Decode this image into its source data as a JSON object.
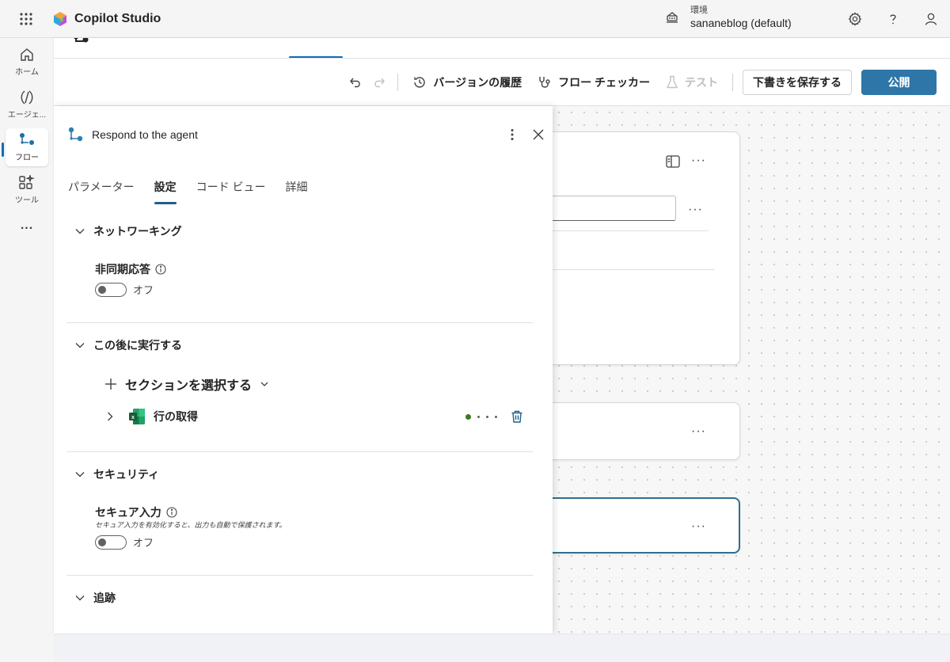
{
  "app": {
    "title": "Copilot Studio"
  },
  "environment": {
    "label": "環境",
    "name": "sananeblog (default)"
  },
  "header_icons": [
    "waffle-icon",
    "environment-icon",
    "gear-icon",
    "help-icon",
    "person-icon"
  ],
  "rail": {
    "items": [
      {
        "id": "home",
        "label": "ホーム",
        "icon": "home-icon",
        "active": false
      },
      {
        "id": "agents",
        "label": "エージェ...",
        "icon": "agent-icon",
        "active": false
      },
      {
        "id": "flows",
        "label": "フロー",
        "icon": "flow-icon",
        "active": true
      },
      {
        "id": "tools",
        "label": "ツール",
        "icon": "tools-icon",
        "active": false
      }
    ],
    "more": "..."
  },
  "toolbar": {
    "undo_icon": "undo-icon",
    "redo_icon": "redo-icon",
    "version_history": "バージョンの履歴",
    "flow_checker": "フロー チェッカー",
    "test": "テスト",
    "save_draft": "下書きを保存する",
    "publish": "公開"
  },
  "panel": {
    "title": "Respond to the agent",
    "tabs": [
      {
        "label": "パラメーター",
        "active": false
      },
      {
        "label": "設定",
        "active": true
      },
      {
        "label": "コード ビュー",
        "active": false
      },
      {
        "label": "詳細",
        "active": false
      }
    ],
    "networking": {
      "heading": "ネットワーキング",
      "async_label": "非同期応答",
      "async_state": "オフ"
    },
    "run_after": {
      "heading": "この後に実行する",
      "select_section": "セクションを選択する",
      "action_name": "行の取得",
      "action_icon": "excel-icon",
      "status_color": "#3b7a1f"
    },
    "security": {
      "heading": "セキュリティ",
      "secure_input_label": "セキュア入力",
      "secure_input_hint": "セキュア入力を有効化すると、出力も自動で保護されます。",
      "secure_input_state": "オフ"
    },
    "tracking": {
      "heading": "追跡"
    }
  },
  "colors": {
    "accent": "#0f6cbd",
    "primary_button": "#2e76a8",
    "tab_underline": "#1f5f8b",
    "selected_node_border": "#2f6f8f"
  }
}
